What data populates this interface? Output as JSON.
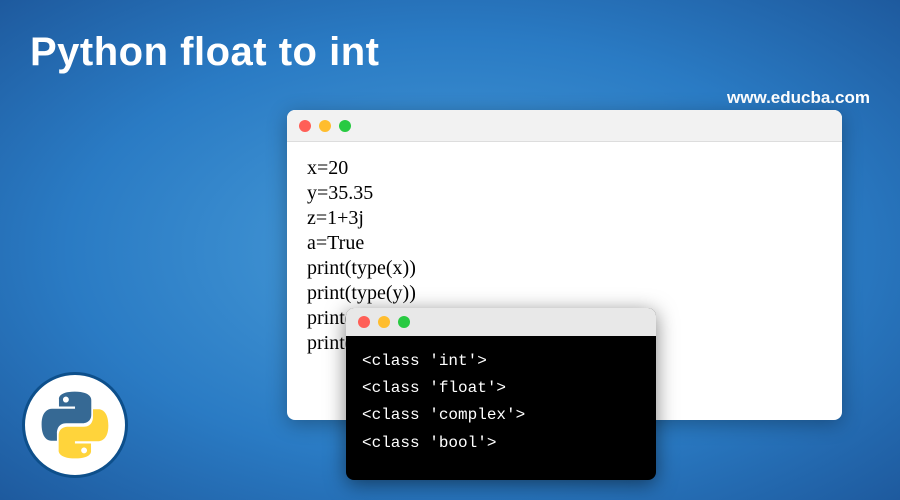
{
  "title": "Python float to int",
  "watermark": "www.educba.com",
  "code_window": {
    "lines": [
      "x=20",
      "y=35.35",
      "z=1+3j",
      "a=True",
      "print(type(x))",
      "print(type(y))",
      "print(type(z))",
      "print(type(a))"
    ]
  },
  "terminal_window": {
    "lines": [
      "<class 'int'>",
      "<class 'float'>",
      "<class 'complex'>",
      "<class 'bool'>"
    ]
  },
  "logo": {
    "name": "python-logo"
  },
  "colors": {
    "bg_center": "#4a9eda",
    "bg_edge": "#1e5a9e",
    "title_text": "#ffffff",
    "code_bg": "#ffffff",
    "terminal_bg": "#000000",
    "terminal_text": "#ffffff",
    "dot_red": "#ff5f57",
    "dot_yellow": "#ffbd2e",
    "dot_green": "#28ca42",
    "python_blue": "#366994",
    "python_yellow": "#ffd43b"
  }
}
